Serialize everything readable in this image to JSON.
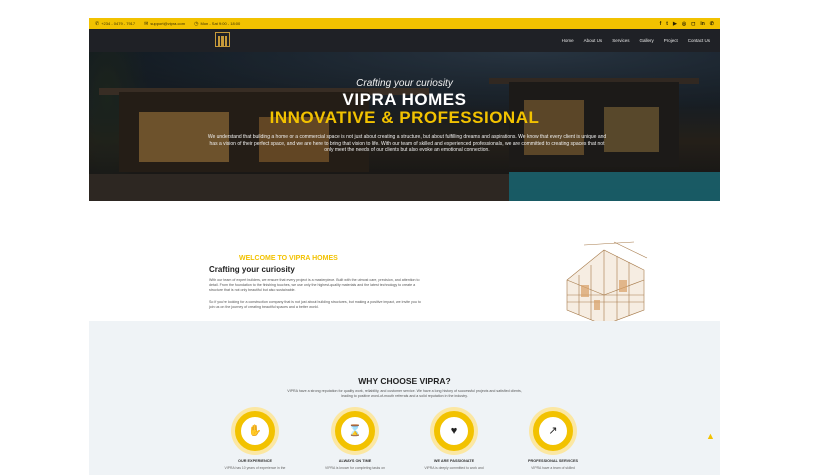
{
  "topbar": {
    "phone": "+234 - 0479 - 7917",
    "email": "support@vipra.com",
    "hours": "Mon - Sat 9:00 - 18:00",
    "social": [
      {
        "icon": "facebook-icon",
        "glyph": "f"
      },
      {
        "icon": "twitter-icon",
        "glyph": "t"
      },
      {
        "icon": "youtube-icon",
        "glyph": "▶"
      },
      {
        "icon": "dribbble-icon",
        "glyph": "◎"
      },
      {
        "icon": "instagram-icon",
        "glyph": "◻"
      },
      {
        "icon": "linkedin-icon",
        "glyph": "in"
      },
      {
        "icon": "whatsapp-icon",
        "glyph": "✆"
      }
    ]
  },
  "nav": {
    "items": [
      "Home",
      "About Us",
      "Services",
      "Gallery",
      "Project",
      "Contact Us"
    ]
  },
  "hero": {
    "tagline": "Crafting your curiosity",
    "brand": "VIPRA HOMES",
    "headline": "INNOVATIVE & PROFESSIONAL",
    "description": "We understand that building a home or a commercial space is not just about creating a structure, but about fulfilling dreams and aspirations. We know that every client is unique and has a vision of their perfect space, and we are here to bring that vision to life. With our team of skilled and experienced professionals, we are committed to creating spaces that not only meet the needs of our clients but also evoke an emotional connection."
  },
  "welcome": {
    "title": "WELCOME TO VIPRA HOMES",
    "subtitle": "Crafting your curiosity",
    "p1": "With our team of expert builders, we ensure that every project is a masterpiece. Built with the utmost care, precision, and attention to detail. From the foundation to the finishing touches, we use only the highest-quality materials and the latest technology to create a structure that is not only beautiful but also sustainable.",
    "p2": "So if you're looking for a construction company that is not just about building structures, but making a positive impact, we invite you to join us on the journey of creating beautiful spaces and a better world."
  },
  "why": {
    "title": "WHY CHOOSE VIPRA?",
    "description": "VIPRA have a strong reputation for quality work, reliability, and customer service. We have a long history of successful projects and satisfied clients, leading to positive word-of-mouth referrals and a solid reputation in the industry.",
    "features": [
      {
        "icon": "handshake-icon",
        "glyph": "✋",
        "title": "OUR EXPERIENCE",
        "desc": "VIPRA has 10 years of experience in the"
      },
      {
        "icon": "hourglass-icon",
        "glyph": "⌛",
        "title": "ALWAYS ON TIME",
        "desc": "VIPRA is known for completing tasks on"
      },
      {
        "icon": "heart-icon",
        "glyph": "♥",
        "title": "WE ARE PASSIONATE",
        "desc": "VIPRA is deeply committed to work and"
      },
      {
        "icon": "chart-icon",
        "glyph": "↗",
        "title": "PROFESSIONAL SERVICES",
        "desc": "VIPRA have a team of skilled"
      }
    ]
  },
  "colors": {
    "accent": "#f2c200",
    "dark": "#1f2126",
    "section_bg": "#eff3f6"
  }
}
